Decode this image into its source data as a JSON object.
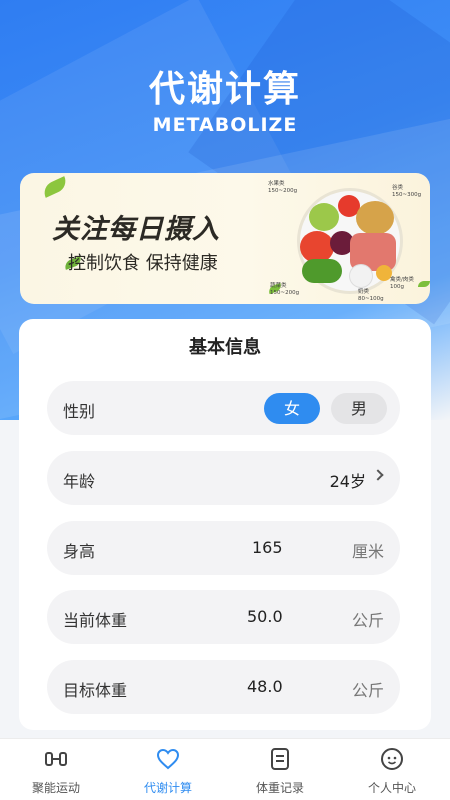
{
  "header": {
    "title": "代谢计算",
    "subtitle": "METABOLIZE"
  },
  "banner": {
    "headline": "关注每日摄入",
    "tagline": "控制饮食 保持健康",
    "food_labels": {
      "fruit": "水果类\n150~200g",
      "grain": "谷类\n150~300g",
      "vegetable": "蔬菜类\n150~200g",
      "meat": "禽类/肉类\n100g",
      "milk": "奶类\n80~100g"
    }
  },
  "form": {
    "title": "基本信息",
    "gender": {
      "label": "性别",
      "options": [
        "女",
        "男"
      ],
      "selected": "女"
    },
    "age": {
      "label": "年龄",
      "value": "24岁"
    },
    "height": {
      "label": "身高",
      "value": "165",
      "unit": "厘米"
    },
    "current_weight": {
      "label": "当前体重",
      "value": "50.0",
      "unit": "公斤"
    },
    "target_weight": {
      "label": "目标体重",
      "value": "48.0",
      "unit": "公斤"
    }
  },
  "tabbar": {
    "items": [
      {
        "label": "聚能运动",
        "icon": "dumbbell-icon"
      },
      {
        "label": "代谢计算",
        "icon": "heart-icon",
        "active": true
      },
      {
        "label": "体重记录",
        "icon": "notebook-icon"
      },
      {
        "label": "个人中心",
        "icon": "smiley-face-icon"
      }
    ]
  },
  "colors": {
    "accent": "#2f8cf0",
    "hero": "#3f8ef6"
  }
}
